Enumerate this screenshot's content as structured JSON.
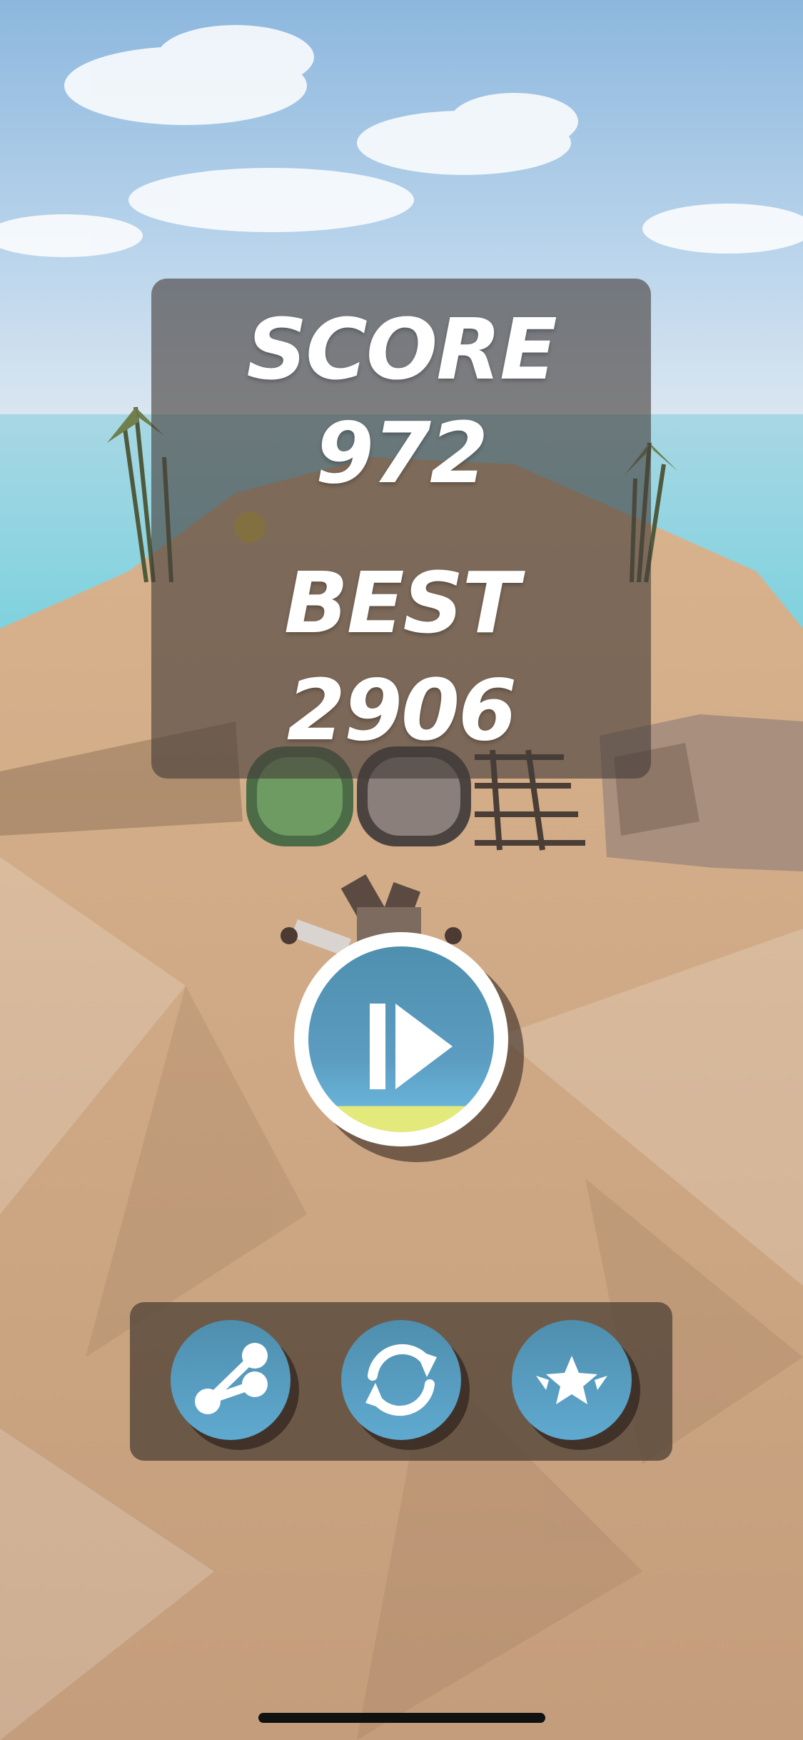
{
  "score_panel": {
    "score_label": "SCORE",
    "score_value": "972",
    "best_label": "BEST",
    "best_value": "2906"
  },
  "buttons": {
    "play": "play-icon",
    "share": "share-icon",
    "restart": "restart-icon",
    "rate": "star-icon"
  },
  "colors": {
    "button_blue": "#5b9cc0",
    "button_accent_yellow": "#e3e97a",
    "panel_bg": "#463e3a",
    "sand": "#c9a27e",
    "sea": "#7fd3e0"
  }
}
